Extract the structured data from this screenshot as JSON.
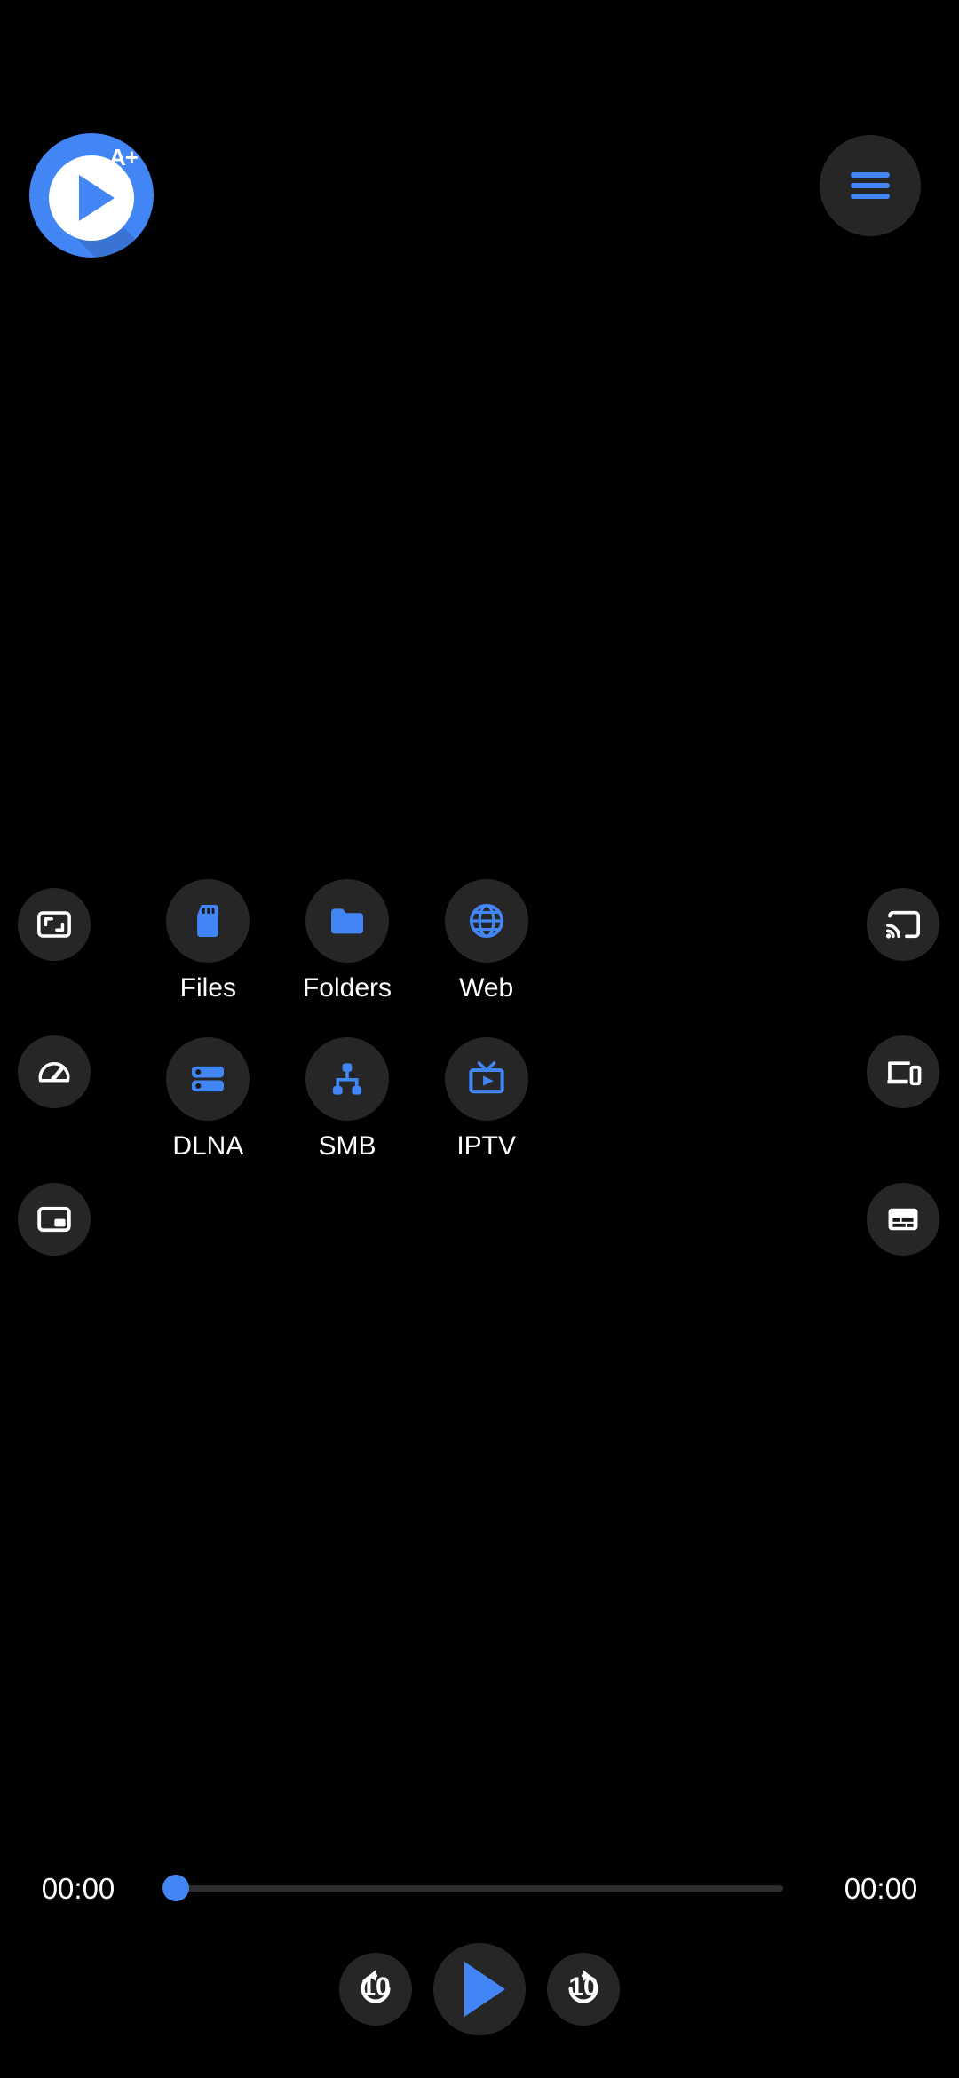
{
  "app": {
    "logo_badge": "A+",
    "logo_name": "app-logo-play",
    "accent_color": "#4285F4",
    "surface_color": "#262626",
    "background_color": "#000000",
    "text_color": "#FFFFFF"
  },
  "top_bar": {
    "menu_button_name": "hamburger-menu-icon"
  },
  "left_rail": [
    {
      "name": "aspect-ratio-icon",
      "label": "Aspect ratio"
    },
    {
      "name": "playback-speed-icon",
      "label": "Playback speed"
    },
    {
      "name": "picture-in-picture-icon",
      "label": "Picture in picture"
    }
  ],
  "right_rail": [
    {
      "name": "cast-icon",
      "label": "Cast"
    },
    {
      "name": "devices-icon",
      "label": "Devices"
    },
    {
      "name": "subtitles-icon",
      "label": "Subtitles"
    }
  ],
  "source_grid": {
    "rows": [
      [
        {
          "label": "Files",
          "icon": "sd-card-icon"
        },
        {
          "label": "Folders",
          "icon": "folder-icon"
        },
        {
          "label": "Web",
          "icon": "globe-icon"
        }
      ],
      [
        {
          "label": "DLNA",
          "icon": "server-icon"
        },
        {
          "label": "SMB",
          "icon": "network-tree-icon"
        },
        {
          "label": "IPTV",
          "icon": "tv-play-icon"
        }
      ]
    ]
  },
  "player": {
    "current_time": "00:00",
    "total_time": "00:00",
    "progress_percent": 0,
    "controls": {
      "rewind_seconds": "10",
      "forward_seconds": "10",
      "play_state": "paused"
    }
  }
}
